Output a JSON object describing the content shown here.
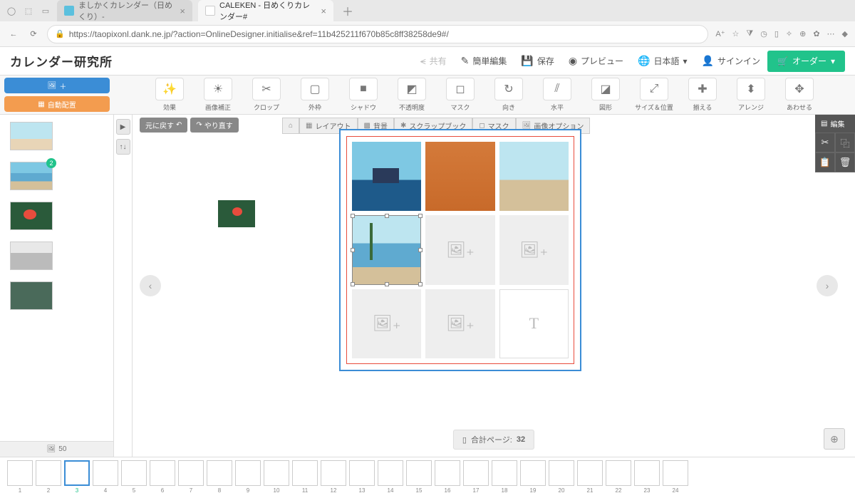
{
  "browser": {
    "tab1": "ましかくカレンダー（日めくり）- ",
    "tab2": "CALEKEN - 日めくりカレンダー#",
    "url": "https://taopixonl.dank.ne.jp/?action=OnlineDesigner.initialise&ref=11b425211f670b85c8ff38258de9#/"
  },
  "header": {
    "logo": "カレンダー研究所",
    "share": "共有",
    "simple_edit": "簡単編集",
    "save": "保存",
    "preview": "プレビュー",
    "language": "日本語",
    "signin": "サインイン",
    "order": "オーダー"
  },
  "side": {
    "add_image": "＋",
    "auto_layout": "自動配置",
    "badge2": "2",
    "photo_count": "50"
  },
  "toolbar": {
    "effect": "効果",
    "correction": "画像補正",
    "crop": "クロップ",
    "frame": "外枠",
    "shadow": "シャドウ",
    "opacity": "不透明度",
    "mask": "マスク",
    "orientation": "向き",
    "level": "水平",
    "shape": "図形",
    "size_pos": "サイズ＆位置",
    "align": "揃える",
    "arrange": "アレンジ",
    "fit": "あわせる"
  },
  "secbar": {
    "undo": "元に戻す",
    "redo": "やり直す",
    "layout": "レイアウト",
    "background": "背景",
    "scrapbook": "スクラップブック",
    "mask": "マスク",
    "image_options": "画像オプション"
  },
  "right": {
    "edit": "編集"
  },
  "footer": {
    "page_label": "合計ページ:",
    "page_count": "32"
  },
  "strip_start": 1,
  "strip_active": 3,
  "strip_end": 24
}
